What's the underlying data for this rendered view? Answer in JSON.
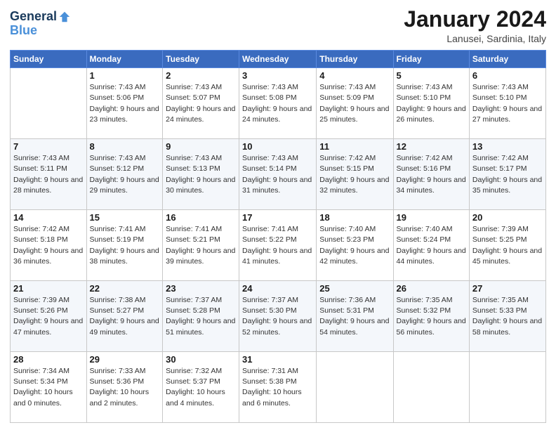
{
  "header": {
    "logo_line1": "General",
    "logo_line2": "Blue",
    "month_title": "January 2024",
    "subtitle": "Lanusei, Sardinia, Italy"
  },
  "days_of_week": [
    "Sunday",
    "Monday",
    "Tuesday",
    "Wednesday",
    "Thursday",
    "Friday",
    "Saturday"
  ],
  "weeks": [
    [
      {
        "day": "",
        "info": ""
      },
      {
        "day": "1",
        "info": "Sunrise: 7:43 AM\nSunset: 5:06 PM\nDaylight: 9 hours and 23 minutes."
      },
      {
        "day": "2",
        "info": "Sunrise: 7:43 AM\nSunset: 5:07 PM\nDaylight: 9 hours and 24 minutes."
      },
      {
        "day": "3",
        "info": "Sunrise: 7:43 AM\nSunset: 5:08 PM\nDaylight: 9 hours and 24 minutes."
      },
      {
        "day": "4",
        "info": "Sunrise: 7:43 AM\nSunset: 5:09 PM\nDaylight: 9 hours and 25 minutes."
      },
      {
        "day": "5",
        "info": "Sunrise: 7:43 AM\nSunset: 5:10 PM\nDaylight: 9 hours and 26 minutes."
      },
      {
        "day": "6",
        "info": "Sunrise: 7:43 AM\nSunset: 5:10 PM\nDaylight: 9 hours and 27 minutes."
      }
    ],
    [
      {
        "day": "7",
        "info": "Sunrise: 7:43 AM\nSunset: 5:11 PM\nDaylight: 9 hours and 28 minutes."
      },
      {
        "day": "8",
        "info": "Sunrise: 7:43 AM\nSunset: 5:12 PM\nDaylight: 9 hours and 29 minutes."
      },
      {
        "day": "9",
        "info": "Sunrise: 7:43 AM\nSunset: 5:13 PM\nDaylight: 9 hours and 30 minutes."
      },
      {
        "day": "10",
        "info": "Sunrise: 7:43 AM\nSunset: 5:14 PM\nDaylight: 9 hours and 31 minutes."
      },
      {
        "day": "11",
        "info": "Sunrise: 7:42 AM\nSunset: 5:15 PM\nDaylight: 9 hours and 32 minutes."
      },
      {
        "day": "12",
        "info": "Sunrise: 7:42 AM\nSunset: 5:16 PM\nDaylight: 9 hours and 34 minutes."
      },
      {
        "day": "13",
        "info": "Sunrise: 7:42 AM\nSunset: 5:17 PM\nDaylight: 9 hours and 35 minutes."
      }
    ],
    [
      {
        "day": "14",
        "info": "Sunrise: 7:42 AM\nSunset: 5:18 PM\nDaylight: 9 hours and 36 minutes."
      },
      {
        "day": "15",
        "info": "Sunrise: 7:41 AM\nSunset: 5:19 PM\nDaylight: 9 hours and 38 minutes."
      },
      {
        "day": "16",
        "info": "Sunrise: 7:41 AM\nSunset: 5:21 PM\nDaylight: 9 hours and 39 minutes."
      },
      {
        "day": "17",
        "info": "Sunrise: 7:41 AM\nSunset: 5:22 PM\nDaylight: 9 hours and 41 minutes."
      },
      {
        "day": "18",
        "info": "Sunrise: 7:40 AM\nSunset: 5:23 PM\nDaylight: 9 hours and 42 minutes."
      },
      {
        "day": "19",
        "info": "Sunrise: 7:40 AM\nSunset: 5:24 PM\nDaylight: 9 hours and 44 minutes."
      },
      {
        "day": "20",
        "info": "Sunrise: 7:39 AM\nSunset: 5:25 PM\nDaylight: 9 hours and 45 minutes."
      }
    ],
    [
      {
        "day": "21",
        "info": "Sunrise: 7:39 AM\nSunset: 5:26 PM\nDaylight: 9 hours and 47 minutes."
      },
      {
        "day": "22",
        "info": "Sunrise: 7:38 AM\nSunset: 5:27 PM\nDaylight: 9 hours and 49 minutes."
      },
      {
        "day": "23",
        "info": "Sunrise: 7:37 AM\nSunset: 5:28 PM\nDaylight: 9 hours and 51 minutes."
      },
      {
        "day": "24",
        "info": "Sunrise: 7:37 AM\nSunset: 5:30 PM\nDaylight: 9 hours and 52 minutes."
      },
      {
        "day": "25",
        "info": "Sunrise: 7:36 AM\nSunset: 5:31 PM\nDaylight: 9 hours and 54 minutes."
      },
      {
        "day": "26",
        "info": "Sunrise: 7:35 AM\nSunset: 5:32 PM\nDaylight: 9 hours and 56 minutes."
      },
      {
        "day": "27",
        "info": "Sunrise: 7:35 AM\nSunset: 5:33 PM\nDaylight: 9 hours and 58 minutes."
      }
    ],
    [
      {
        "day": "28",
        "info": "Sunrise: 7:34 AM\nSunset: 5:34 PM\nDaylight: 10 hours and 0 minutes."
      },
      {
        "day": "29",
        "info": "Sunrise: 7:33 AM\nSunset: 5:36 PM\nDaylight: 10 hours and 2 minutes."
      },
      {
        "day": "30",
        "info": "Sunrise: 7:32 AM\nSunset: 5:37 PM\nDaylight: 10 hours and 4 minutes."
      },
      {
        "day": "31",
        "info": "Sunrise: 7:31 AM\nSunset: 5:38 PM\nDaylight: 10 hours and 6 minutes."
      },
      {
        "day": "",
        "info": ""
      },
      {
        "day": "",
        "info": ""
      },
      {
        "day": "",
        "info": ""
      }
    ]
  ]
}
